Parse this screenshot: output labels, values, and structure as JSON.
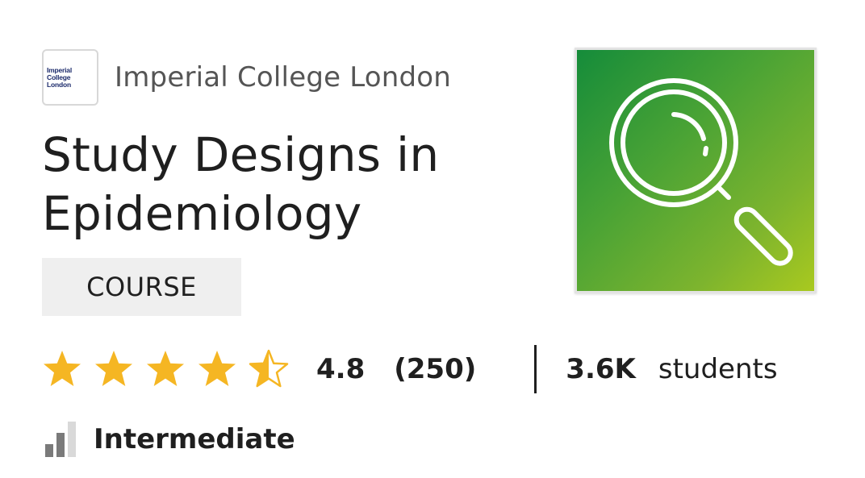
{
  "partner": {
    "logo_text": "Imperial College London",
    "name": "Imperial College London"
  },
  "course": {
    "title": "Study Designs in Epidemiology",
    "type_badge": "COURSE",
    "thumbnail_icon": "magnifying-glass-icon"
  },
  "rating": {
    "stars": 4.5,
    "max_stars": 5,
    "value": "4.8",
    "count": "(250)",
    "star_color": "#f5b623"
  },
  "enrollment": {
    "count": "3.6K",
    "label": "students"
  },
  "level": {
    "label": "Intermediate",
    "icon": "difficulty-bars-icon",
    "filled_bars": 2,
    "total_bars": 3
  },
  "colors": {
    "thumbnail_gradient_start": "#158c3a",
    "thumbnail_gradient_end": "#a9c91f",
    "badge_background": "#efefef"
  }
}
